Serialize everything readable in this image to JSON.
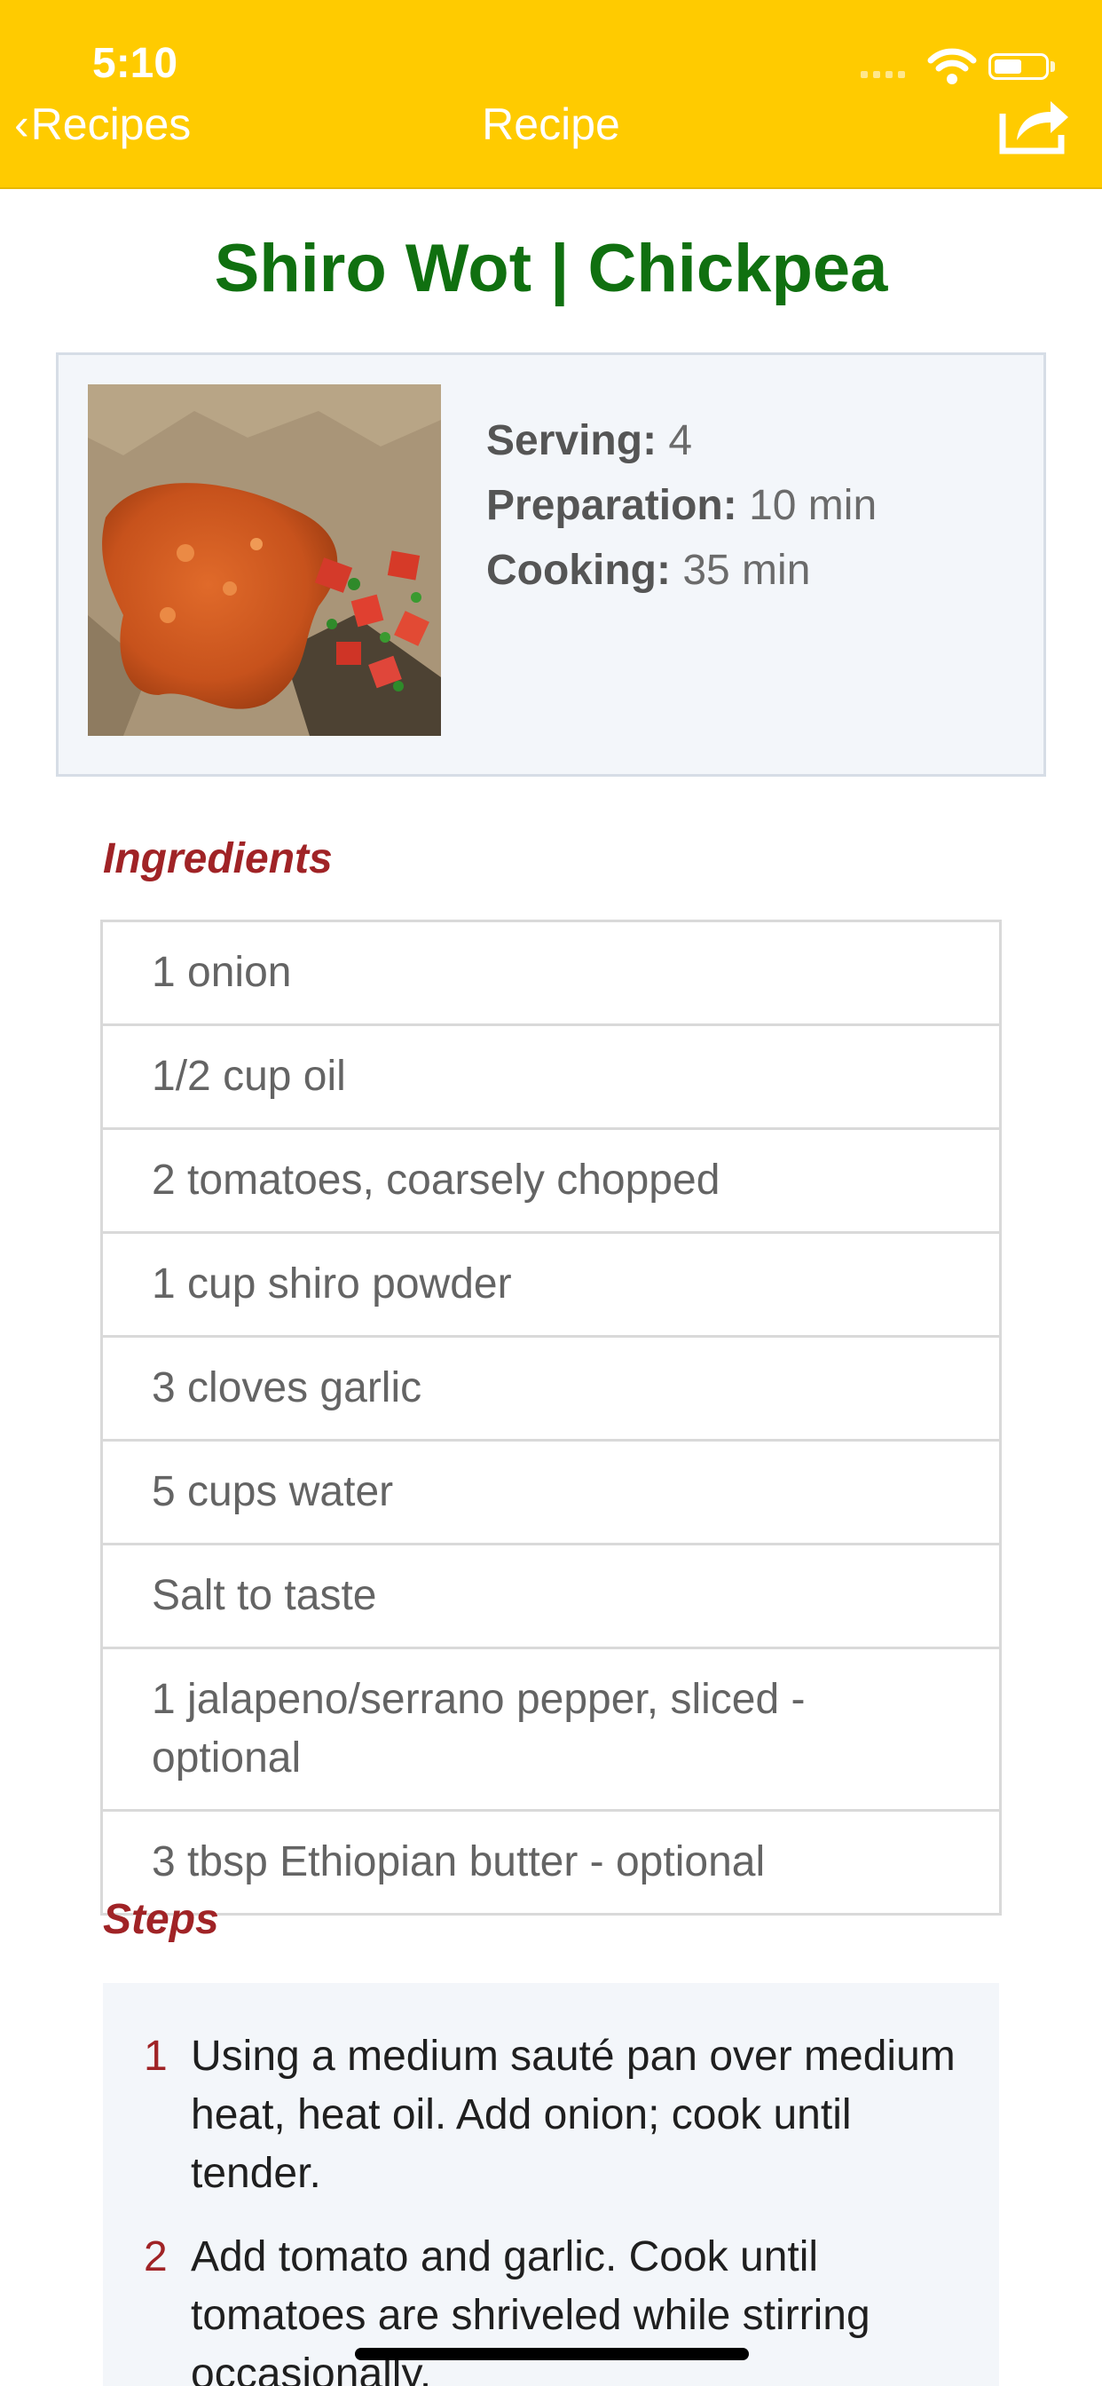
{
  "status_bar": {
    "time": "5:10"
  },
  "nav": {
    "back_label": "Recipes",
    "title": "Recipe",
    "share_icon": "share-icon"
  },
  "recipe": {
    "title": "Shiro Wot | Chickpea",
    "photo": "shiro-wot-photo",
    "serving_label": "Serving:",
    "serving_value": "4",
    "preparation_label": "Preparation:",
    "preparation_value": "10 min",
    "cooking_label": "Cooking:",
    "cooking_value": "35 min"
  },
  "ingredients": {
    "header": "Ingredients",
    "items": [
      "1 onion",
      "1/2 cup oil",
      "2 tomatoes, coarsely chopped",
      "1 cup shiro powder",
      "3 cloves garlic",
      "5 cups water",
      "Salt to taste",
      "1 jalapeno/serrano pepper, sliced - optional",
      "3 tbsp Ethiopian butter - optional"
    ]
  },
  "steps": {
    "header": "Steps",
    "items": [
      {
        "number": "1",
        "text": "Using a medium sauté pan over medium heat, heat oil. Add onion; cook until tender."
      },
      {
        "number": "2",
        "text": "Add tomato and garlic. Cook until tomatoes are shriveled while stirring occasionally."
      }
    ]
  },
  "colors": {
    "nav_bar": "#ffcb00",
    "title_green": "#107010",
    "section_red": "#a02326",
    "card_background": "#f3f6fa"
  }
}
